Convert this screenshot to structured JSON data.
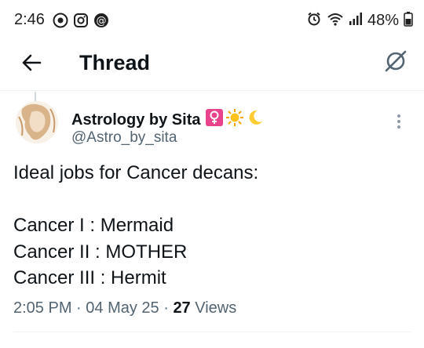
{
  "status_bar": {
    "time": "2:46",
    "battery": "48%",
    "left_icons": [
      "circle-check-icon",
      "instagram-icon",
      "threads-icon"
    ],
    "right_icons": [
      "alarm-icon",
      "wifi-icon",
      "signal-icon",
      "battery-icon"
    ]
  },
  "header": {
    "title": "Thread",
    "back_icon": "back-arrow-icon",
    "grok_icon": "grok-icon"
  },
  "tweet": {
    "author_name": "Astrology by Sita",
    "author_emojis": [
      "♀️",
      "☀️",
      "🌙"
    ],
    "handle": "@Astro_by_sita",
    "body_lines": [
      "Ideal jobs for Cancer decans:",
      "",
      "Cancer I : Mermaid",
      "Cancer II : MOTHER",
      "Cancer III : Hermit"
    ],
    "time": "2:05 PM",
    "date": "04 May 25",
    "views_count": "27",
    "views_label": "Views"
  },
  "colors": {
    "text_primary": "#0f1419",
    "text_secondary": "#536471",
    "divider": "#eff3f4"
  }
}
